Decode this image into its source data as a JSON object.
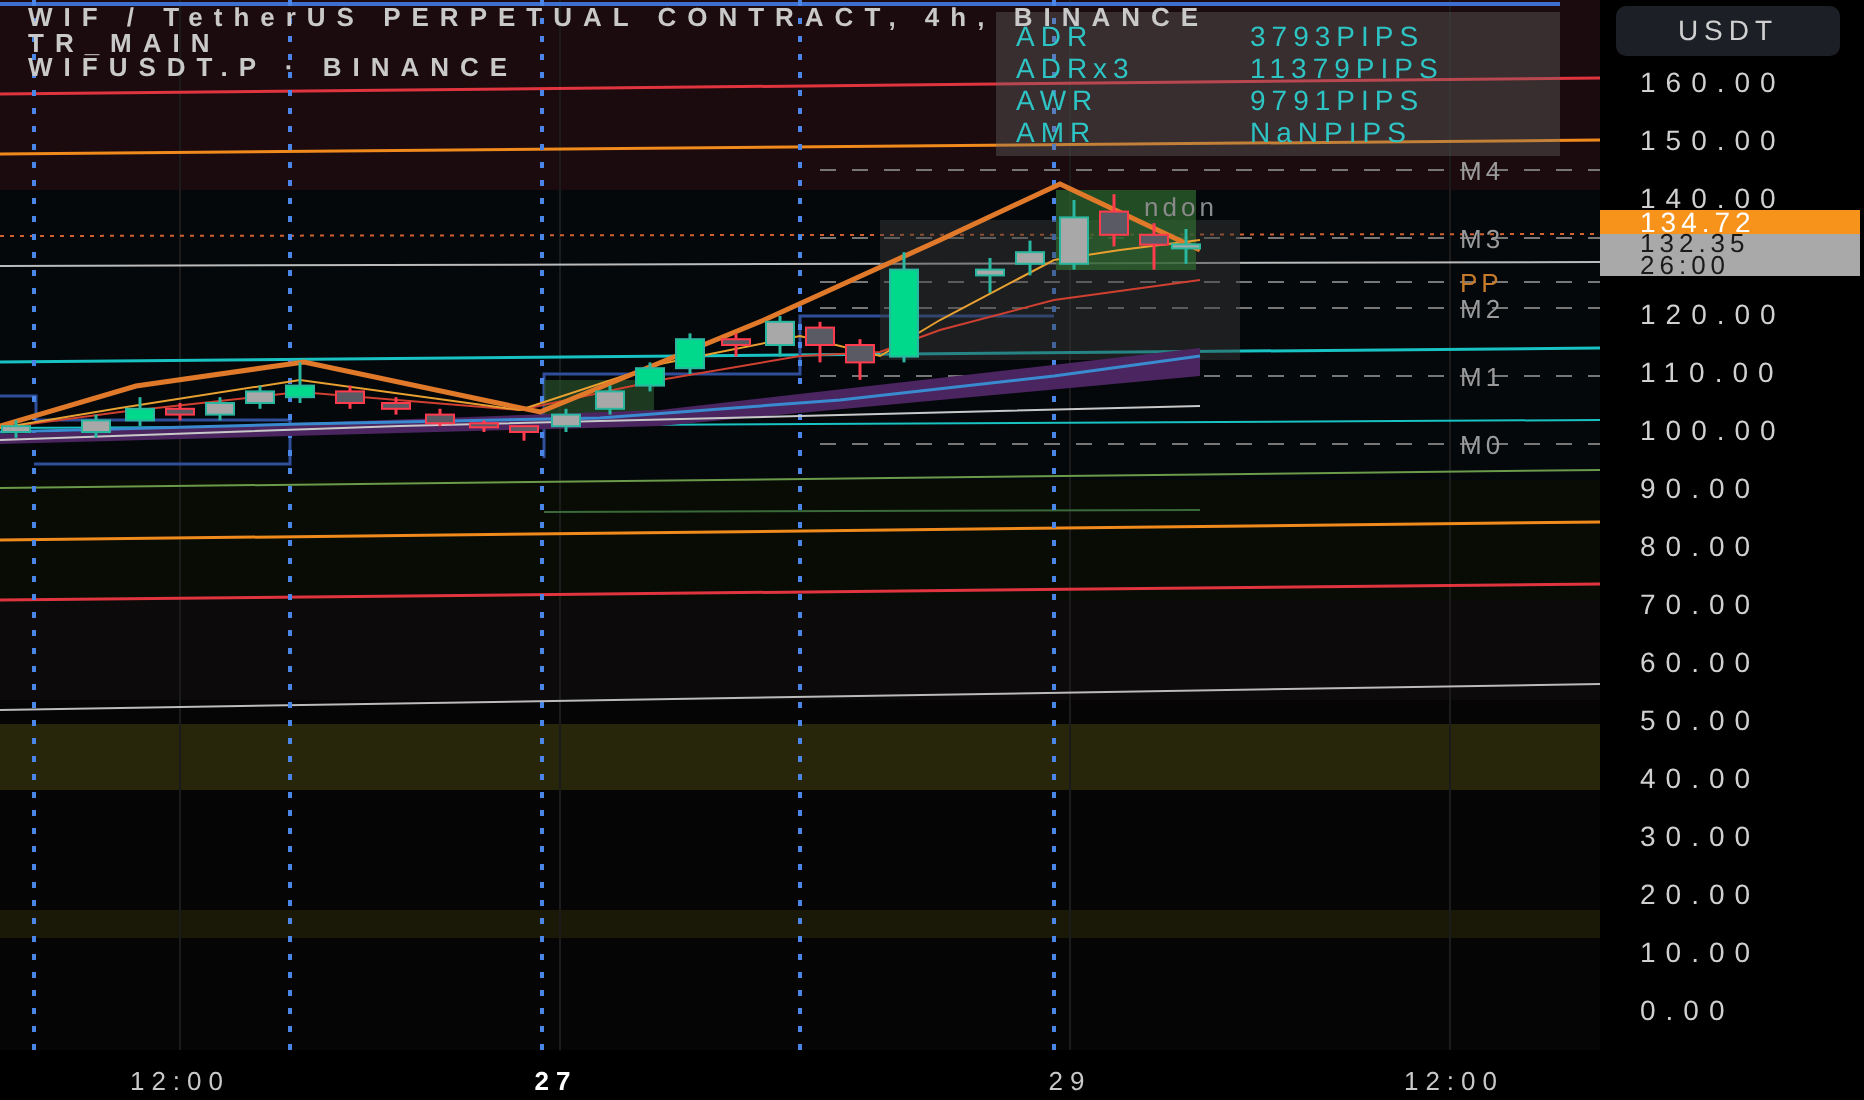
{
  "header": {
    "title": "WIF / TetherUS PERPETUAL CONTRACT, 4h, BINANCE",
    "indicator": "TR_MAIN",
    "symbol": "WIFUSDT.P · BINANCE"
  },
  "range_table": [
    {
      "label": "ADR",
      "value": "3793PIPS"
    },
    {
      "label": "ADRx3",
      "value": "11379PIPS"
    },
    {
      "label": "AWR",
      "value": "9791PIPS"
    },
    {
      "label": "AMR",
      "value": "NaNPIPS"
    }
  ],
  "level_labels": [
    {
      "text": "M4",
      "color": "#9a9a9a"
    },
    {
      "text": "M3",
      "color": "#9a9a9a"
    },
    {
      "text": "PP",
      "color": "#c77a2a"
    },
    {
      "text": "M2",
      "color": "#9a9a9a"
    },
    {
      "text": "M1",
      "color": "#9a9a9a"
    },
    {
      "text": "M0",
      "color": "#9a9a9a"
    }
  ],
  "session_label": "ndon",
  "price_axis": {
    "currency_button": "USDT",
    "labels": [
      "160.00",
      "150.00",
      "140.00",
      "120.00",
      "110.00",
      "100.00",
      "90.00",
      "80.00",
      "70.00",
      "60.00",
      "50.00",
      "40.00",
      "30.00",
      "20.00",
      "10.00",
      "0.00"
    ],
    "last_price": "134.72",
    "price_tag": "132.35",
    "countdown": "26:00"
  },
  "time_axis": {
    "labels": [
      {
        "text": "12:00",
        "bold": false
      },
      {
        "text": "27",
        "bold": true
      },
      {
        "text": "29",
        "bold": false
      },
      {
        "text": "12:00",
        "bold": false
      }
    ]
  }
}
